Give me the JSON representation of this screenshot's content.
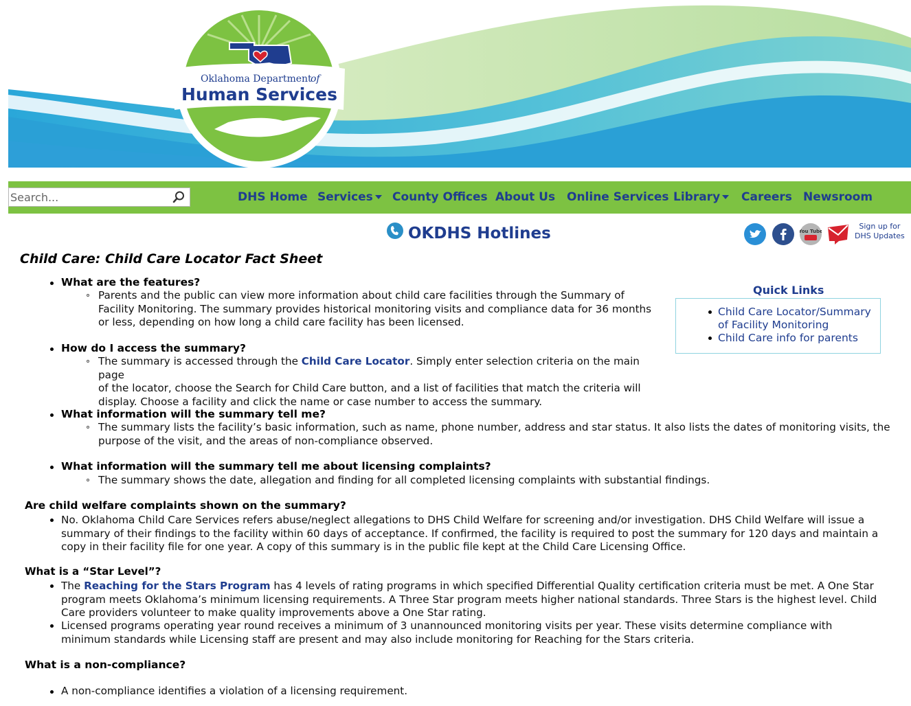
{
  "header": {
    "logo_line1": "Oklahoma Department",
    "logo_of": "of",
    "logo_line2": "Human Services",
    "colors": {
      "green": "#7dc242",
      "navy": "#1f3d8f",
      "teal": "#4fc2d6",
      "light_green": "#c5e3a5"
    }
  },
  "nav": {
    "search_placeholder": "Search...",
    "items": [
      {
        "label": "DHS Home"
      },
      {
        "label": "Services",
        "dropdown": true
      },
      {
        "label": "County Offices"
      },
      {
        "label": "About Us"
      },
      {
        "label": "Online Services"
      },
      {
        "label": "Library",
        "dropdown": true
      },
      {
        "label": "Careers"
      },
      {
        "label": "Newsroom"
      }
    ]
  },
  "hotline": {
    "label": "OKDHS Hotlines",
    "icon": "phone-icon"
  },
  "social": {
    "icons": [
      "twitter-icon",
      "facebook-icon",
      "youtube-icon",
      "email-icon"
    ],
    "youtube_text": "You Tube",
    "signup_line1": "Sign up for",
    "signup_line2": "DHS Updates"
  },
  "page_title": "Child Care: Child Care Locator Fact Sheet",
  "quick_links": {
    "title": "Quick Links",
    "items": [
      {
        "line1": "Child Care Locator/Summary",
        "line2": "of Facility Monitoring"
      },
      {
        "line1": "Child Care info for parents"
      }
    ]
  },
  "sections": {
    "q1": "What are the features?",
    "a1_lines": [
      "Parents and the public can view more information about child care facilities through the Summary of",
      "Facility Monitoring. The summary provides historical monitoring visits and compliance data for 36 months",
      "or less, depending on how long a child care facility has been licensed."
    ],
    "q2": "How do I access the summary?",
    "a2_pre": "The summary is accessed through the ",
    "a2_link": "Child Care Locator",
    "a2_post": ". Simply enter selection criteria on the main page",
    "a2_lines": [
      "of the locator, choose the Search for Child Care button, and a list of facilities that match the criteria will",
      "display. Choose a facility and click the name or case number to access the summary."
    ],
    "q3": "What information will the summary tell me?",
    "a3_lines": [
      "The summary lists the facility’s basic information, such as name, phone number, address and star status. It also lists the dates of monitoring visits, the",
      "purpose of the visit, and the areas of non-compliance observed."
    ],
    "q4": "What information will the summary tell me about licensing complaints?",
    "a4": "The summary shows the date, allegation and finding for all completed licensing complaints with substantial findings.",
    "h5": "Are child welfare complaints shown on the summary?",
    "a5_lines": [
      "No. Oklahoma Child Care Services refers abuse/neglect allegations to DHS Child Welfare for screening and/or investigation. DHS Child Welfare will issue a",
      "summary of their findings to the facility within 60 days of acceptance. If confirmed, the facility is required to post the summary for 120 days and maintain a",
      "copy in their facility file for one year. A copy of this summary is in the public file kept at the Child Care Licensing Office."
    ],
    "h6": "What is a “Star Level”?",
    "a6a_pre": "The ",
    "a6a_link": "Reaching for the Stars Program",
    "a6a_post": " has 4 levels of rating programs in which specified Differential Quality certification criteria must be met.   A One Star",
    "a6a_lines": [
      "program meets Oklahoma’s minimum licensing requirements.  A Three Star program meets higher national standards. Three Stars is the highest level.  Child",
      "Care providers volunteer to make quality improvements above a One Star rating."
    ],
    "a6b_lines": [
      "Licensed programs operating year round receives a minimum of 3 unannounced monitoring visits per year. These visits determine compliance with",
      "minimum standards while Licensing staff are present and may also include monitoring for Reaching for the Stars criteria."
    ],
    "h7": "What is a non-compliance?",
    "a7": "A non-compliance identifies a violation of a licensing requirement."
  }
}
